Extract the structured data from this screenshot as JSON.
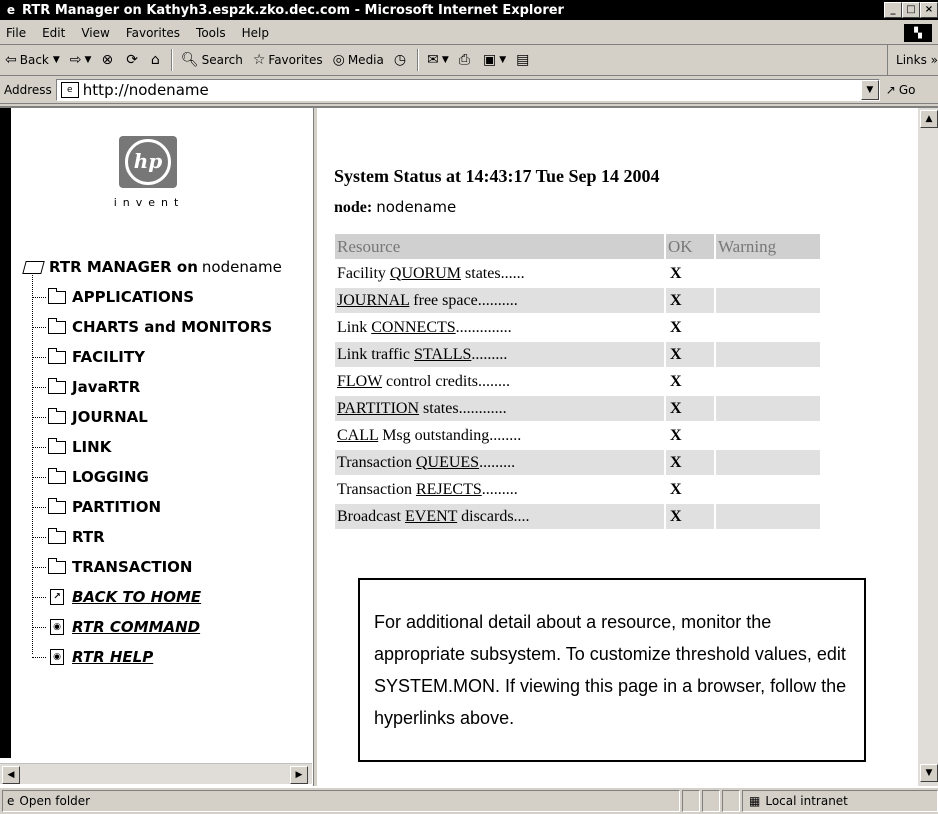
{
  "window": {
    "title": "RTR Manager on Kathyh3.espzk.zko.dec.com - Microsoft Internet Explorer",
    "min": "_",
    "max": "□",
    "close": "×"
  },
  "menu": [
    "File",
    "Edit",
    "View",
    "Favorites",
    "Tools",
    "Help"
  ],
  "toolbar": {
    "back": "Back",
    "search": "Search",
    "favorites": "Favorites",
    "media": "Media",
    "links": "Links »"
  },
  "address": {
    "label": "Address",
    "value": "http://nodename",
    "go": "Go"
  },
  "left": {
    "logo_text": "hp",
    "logo_tagline": "invent",
    "root_label": "RTR MANAGER on",
    "root_node": "nodename",
    "folders": [
      "APPLICATIONS",
      "CHARTS and MONITORS",
      "FACILITY",
      "JavaRTR",
      "JOURNAL",
      "LINK",
      "LOGGING",
      "PARTITION",
      "RTR",
      "TRANSACTION"
    ],
    "links": [
      "BACK TO HOME",
      "RTR COMMAND",
      "RTR HELP"
    ]
  },
  "main": {
    "heading": "System Status at 14:43:17 Tue Sep 14 2004",
    "node_label": "node:",
    "node_value": "nodename",
    "columns": [
      "Resource",
      "OK",
      "Warning"
    ],
    "rows": [
      {
        "pre": "Facility ",
        "link": "QUORUM",
        "post": " states......",
        "ok": "X"
      },
      {
        "pre": "",
        "link": "JOURNAL",
        "post": " free space..........",
        "ok": "X"
      },
      {
        "pre": "Link ",
        "link": "CONNECTS",
        "post": "..............",
        "ok": "X"
      },
      {
        "pre": "Link traffic ",
        "link": "STALLS",
        "post": ".........",
        "ok": "X"
      },
      {
        "pre": "",
        "link": "FLOW",
        "post": " control credits........",
        "ok": "X"
      },
      {
        "pre": "",
        "link": "PARTITION",
        "post": " states............",
        "ok": "X"
      },
      {
        "pre": "",
        "link": "CALL",
        "post": " Msg outstanding........",
        "ok": "X"
      },
      {
        "pre": "Transaction ",
        "link": "QUEUES",
        "post": ".........",
        "ok": "X"
      },
      {
        "pre": "Transaction ",
        "link": "REJECTS",
        "post": ".........",
        "ok": "X"
      },
      {
        "pre": "Broadcast ",
        "link": "EVENT",
        "post": " discards....",
        "ok": "X"
      }
    ],
    "note": "For additional detail about a resource, monitor the appropriate subsystem. To customize threshold values, edit SYSTEM.MON. If viewing this page in a browser, follow the hyperlinks above."
  },
  "status": {
    "text": "Open folder",
    "zone": "Local intranet"
  }
}
